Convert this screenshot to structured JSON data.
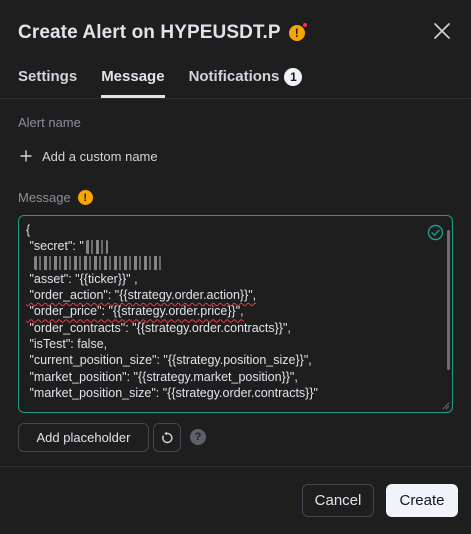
{
  "dialog": {
    "title": "Create Alert on HYPEUSDT.P",
    "warning_icon": "warning-icon",
    "close_icon": "close-icon"
  },
  "tabs": [
    {
      "label": "Settings",
      "active": false
    },
    {
      "label": "Message",
      "active": true
    },
    {
      "label": "Notifications",
      "active": false,
      "count": "1"
    }
  ],
  "alert_name": {
    "label": "Alert name",
    "add_label": "Add a custom name"
  },
  "message": {
    "label": "Message",
    "lines": [
      "{",
      " \"secret\": \"",
      "",
      " \"asset\": \"{{ticker}}\" ,",
      " \"order_action\": \"{{strategy.order.action}}\",",
      " \"order_price\": \"{{strategy.order.price}}\",",
      " \"order_contracts\": \"{{strategy.order.contracts}}\",",
      " \"isTest\": false,",
      " \"current_position_size\": \"{{strategy.position_size}}\",",
      " \"market_position\": \"{{strategy.market_position}}\",",
      " \"market_position_size\": \"{{strategy.order.contracts}}\""
    ]
  },
  "actions": {
    "add_placeholder": "Add placeholder",
    "reset_icon": "reset-icon",
    "help_icon": "help-icon",
    "help_glyph": "?"
  },
  "footer": {
    "cancel": "Cancel",
    "create": "Create"
  },
  "colors": {
    "background": "#1e1e1e",
    "accent_border": "#1f9c8c",
    "warning": "#f7a600",
    "notify_dot": "#f23645"
  }
}
